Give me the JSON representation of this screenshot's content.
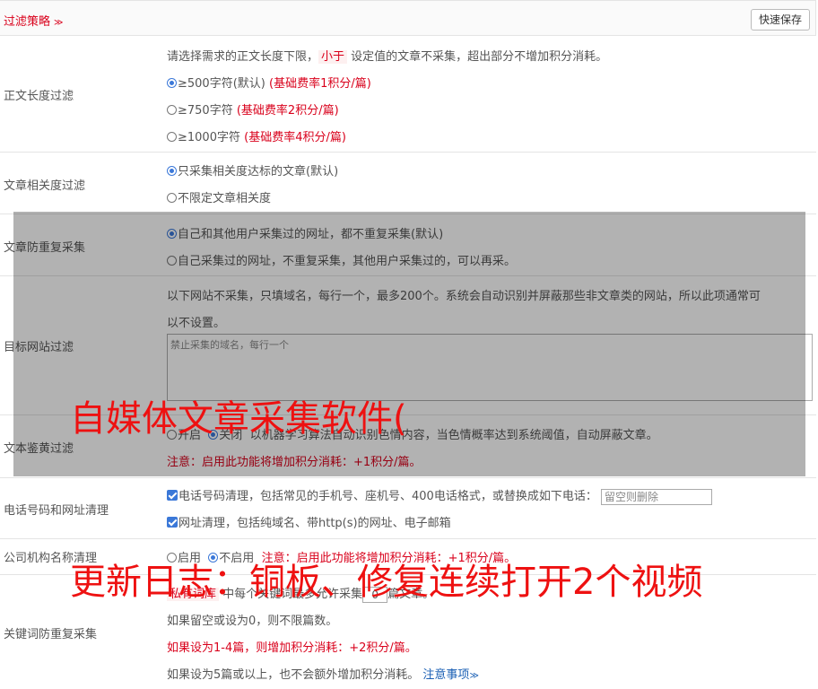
{
  "header": {
    "title": "过滤策略",
    "chevron": "≫",
    "save_label": "快速保存"
  },
  "length": {
    "label": "正文长度过滤",
    "desc_pre": "请选择需求的正文长度下限，",
    "desc_highlight": "小于",
    "desc_post": "设定值的文章不采集，超出部分不增加积分消耗。",
    "options": [
      {
        "text": "≥500字符(默认)",
        "fee": "(基础费率1积分/篇)",
        "checked": true
      },
      {
        "text": "≥750字符",
        "fee": "(基础费率2积分/篇)",
        "checked": false
      },
      {
        "text": "≥1000字符",
        "fee": "(基础费率4积分/篇)",
        "checked": false
      }
    ]
  },
  "relevance": {
    "label": "文章相关度过滤",
    "options": [
      {
        "text": "只采集相关度达标的文章(默认)",
        "checked": true
      },
      {
        "text": "不限定文章相关度",
        "checked": false
      }
    ]
  },
  "dedupe": {
    "label": "文章防重复采集",
    "options": [
      {
        "text": "自己和其他用户采集过的网址，都不重复采集(默认)",
        "checked": true
      },
      {
        "text": "自己采集过的网址，不重复采集，其他用户采集过的，可以再采。",
        "checked": false
      }
    ]
  },
  "target_site": {
    "label": "目标网站过滤",
    "desc_line1": "以下网站不采集，只填域名，每行一个，最多200个。系统会自动识别并屏蔽那些非文章类的网站，所以此项通常可",
    "desc_line2": "以不设置。",
    "placeholder": "禁止采集的域名，每行一个"
  },
  "porn": {
    "label": "文本鉴黄过滤",
    "on_label": "开启",
    "off_label": "关闭",
    "desc": "以机器学习算法自动识别色情内容，当色情概率达到系统阈值，自动屏蔽文章。",
    "note": "注意：启用此功能将增加积分消耗：+1积分/篇。"
  },
  "phone": {
    "label": "电话号码和网址清理",
    "phone_text": "电话号码清理，包括常见的手机号、座机号、400电话格式，或替换成如下电话：",
    "phone_placeholder": "留空则删除",
    "url_text": "网址清理，包括纯域名、带http(s)的网址、电子邮箱"
  },
  "company": {
    "label": "公司机构名称清理",
    "on_label": "启用",
    "off_label": "不启用",
    "note": "注意：启用此功能将增加积分消耗：+1积分/篇。"
  },
  "keyword": {
    "label": "关键词防重复采集",
    "line1_pre": "私有词库",
    "line1_mid": "中每个关键词最多允许采集",
    "line1_value": "0",
    "line1_post": "篇文章。",
    "line2": "如果留空或设为0，则不限篇数。",
    "line3": "如果设为1-4篇，则增加积分消耗：+2积分/篇。",
    "line4": "如果设为5篇或以上，也不会额外增加积分消耗。",
    "notes_link": "注意事项",
    "notes_chevron": "≫"
  },
  "watermarks": {
    "line1": "自媒体文章采集软件(",
    "line2": "更新日志：铜板、修复连续打开2个视频"
  },
  "colors": {
    "accent": "#d9001b",
    "radio": "#3b78d8",
    "link": "#1a5fb4"
  }
}
